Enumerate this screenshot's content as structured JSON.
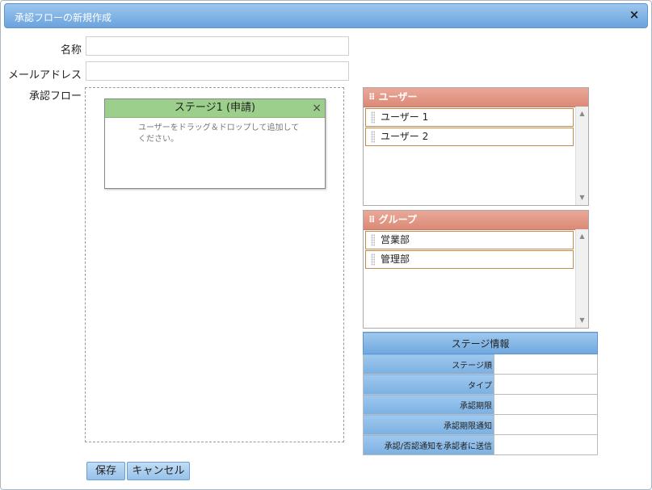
{
  "dialog": {
    "title": "承認フローの新規作成",
    "close_icon": "×"
  },
  "form": {
    "name_label": "名称",
    "name_value": "",
    "email_label": "メールアドレス",
    "email_value": "",
    "flow_label": "承認フロー"
  },
  "stage": {
    "title": "ステージ1 (申請)",
    "close_icon": "×",
    "hint": "ユーザーをドラッグ＆ドロップして追加してください。"
  },
  "users_panel": {
    "title": "ユーザー",
    "items": [
      {
        "label": "ユーザー 1"
      },
      {
        "label": "ユーザー 2"
      }
    ]
  },
  "groups_panel": {
    "title": "グループ",
    "items": [
      {
        "label": "営業部"
      },
      {
        "label": "管理部"
      }
    ]
  },
  "stage_info": {
    "title": "ステージ情報",
    "rows": [
      {
        "key": "ステージ順",
        "value": ""
      },
      {
        "key": "タイプ",
        "value": ""
      },
      {
        "key": "承認期限",
        "value": ""
      },
      {
        "key": "承認期限通知",
        "value": ""
      },
      {
        "key": "承認/否認通知を承認者に送信",
        "value": ""
      }
    ]
  },
  "buttons": {
    "save": "保存",
    "cancel": "キャンセル"
  },
  "colors": {
    "title_bar": "#6aa3dd",
    "stage_header": "#9ccf8c",
    "panel_header": "#db8a76",
    "item_border": "#c78a4d"
  }
}
